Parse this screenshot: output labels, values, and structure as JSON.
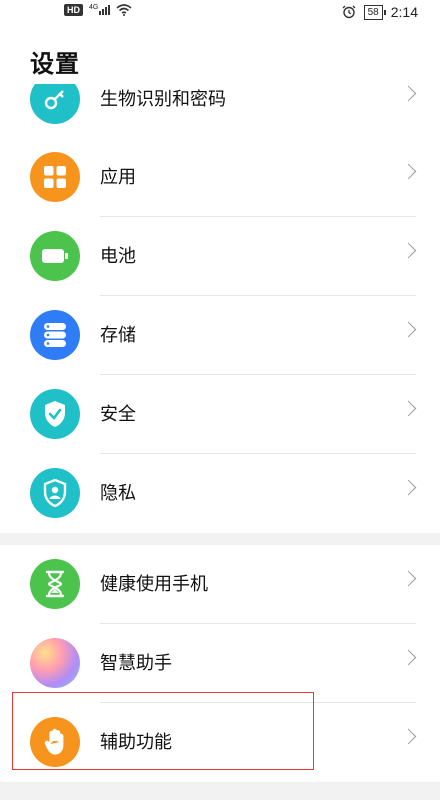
{
  "status_bar": {
    "hd": "HD",
    "network": "4G",
    "battery": "58",
    "time": "2:14"
  },
  "title": "设置",
  "items": [
    {
      "label": "生物识别和密码",
      "icon": "key-icon",
      "color": "#1fc0c8"
    },
    {
      "label": "应用",
      "icon": "apps-grid-icon",
      "color": "#f7941d"
    },
    {
      "label": "电池",
      "icon": "battery-icon",
      "color": "#4cc34c"
    },
    {
      "label": "存储",
      "icon": "storage-icon",
      "color": "#2f7df6"
    },
    {
      "label": "安全",
      "icon": "shield-check-icon",
      "color": "#1fc0c8"
    },
    {
      "label": "隐私",
      "icon": "privacy-icon",
      "color": "#1fc0c8"
    },
    {
      "label": "健康使用手机",
      "icon": "hourglass-icon",
      "color": "#4cc34c"
    },
    {
      "label": "智慧助手",
      "icon": "assistant-icon",
      "color": "#c58cf5"
    },
    {
      "label": "辅助功能",
      "icon": "hand-icon",
      "color": "#f7941d"
    }
  ]
}
